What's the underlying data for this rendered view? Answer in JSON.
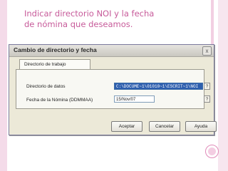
{
  "slide": {
    "line1": "Indicar directorio NOI y la fecha",
    "line2": "de nómina que deseamos."
  },
  "dialog": {
    "title": "Cambio de directorio y fecha",
    "close_label": "x",
    "tab_label": "Directorio de trabajo",
    "data_dir": {
      "label": "Directorio de datos",
      "value": "C:\\DOCUME~1\\01010~1\\ESCRIT~1\\NOI"
    },
    "payroll_date": {
      "label": "Fecha de la Nómina (DDMMAA)",
      "value": "15/Nov/07"
    },
    "help_glyph": "?",
    "buttons": {
      "accept": "Aceptar",
      "cancel": "Cancelar",
      "help": "Ayuda"
    }
  },
  "colors": {
    "slide_text": "#c75b9a",
    "dialog_bg": "#ece9d8",
    "selected_input": "#2e5fae"
  }
}
